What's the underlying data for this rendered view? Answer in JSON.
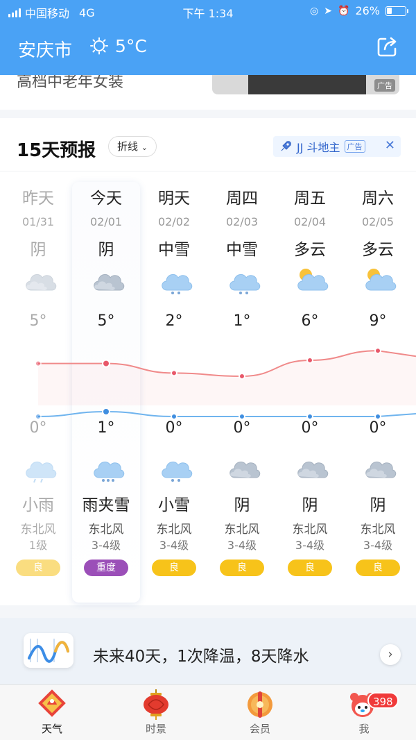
{
  "status_bar": {
    "carrier": "中国移动",
    "network": "4G",
    "time": "下午 1:34",
    "battery": "26%",
    "battery_level": 0.26
  },
  "header": {
    "city": "安庆市",
    "temp": "5°C",
    "weather_icon": "cloudy-sun-icon",
    "share_icon": "share-icon"
  },
  "ad_strip": {
    "text": "高档中老年女装",
    "tag": "广告"
  },
  "forecast": {
    "title": "15天预报",
    "mode_button": "折线",
    "ad": {
      "text": "JJ 斗地主",
      "tag": "广告",
      "close": "✕"
    },
    "days": [
      {
        "name": "昨天",
        "date": "01/31",
        "day_cond": "阴",
        "day_icon": "overcast",
        "high": "5°",
        "low": "0°",
        "night_icon": "rain",
        "night_cond": "小雨",
        "wind": "东北风",
        "level": "1级",
        "aqi": "良",
        "aqi_color": "#f7c31a"
      },
      {
        "name": "今天",
        "date": "02/01",
        "day_cond": "阴",
        "day_icon": "overcast",
        "high": "5°",
        "low": "1°",
        "night_icon": "sleet",
        "night_cond": "雨夹雪",
        "wind": "东北风",
        "level": "3-4级",
        "aqi": "重度",
        "aqi_color": "#9b4fb8"
      },
      {
        "name": "明天",
        "date": "02/02",
        "day_cond": "中雪",
        "day_icon": "snow",
        "high": "2°",
        "low": "0°",
        "night_icon": "light-snow",
        "night_cond": "小雪",
        "wind": "东北风",
        "level": "3-4级",
        "aqi": "良",
        "aqi_color": "#f7c31a"
      },
      {
        "name": "周四",
        "date": "02/03",
        "day_cond": "中雪",
        "day_icon": "snow",
        "high": "1°",
        "low": "0°",
        "night_icon": "overcast",
        "night_cond": "阴",
        "wind": "东北风",
        "level": "3-4级",
        "aqi": "良",
        "aqi_color": "#f7c31a"
      },
      {
        "name": "周五",
        "date": "02/04",
        "day_cond": "多云",
        "day_icon": "partly-cloudy",
        "high": "6°",
        "low": "0°",
        "night_icon": "overcast",
        "night_cond": "阴",
        "wind": "东北风",
        "level": "3-4级",
        "aqi": "良",
        "aqi_color": "#f7c31a"
      },
      {
        "name": "周六",
        "date": "02/05",
        "day_cond": "多云",
        "day_icon": "partly-cloudy",
        "high": "9°",
        "low": "0°",
        "night_icon": "overcast",
        "night_cond": "阴",
        "wind": "东北风",
        "level": "3-4级",
        "aqi": "良",
        "aqi_color": "#f7c31a"
      }
    ],
    "high_values": [
      5,
      5,
      2,
      1,
      6,
      9
    ],
    "low_values": [
      0,
      1,
      0,
      0,
      0,
      0
    ],
    "colors": {
      "high_line": "#f08a8a",
      "low_line": "#6fb4ee",
      "accent": "#4aa2f5"
    }
  },
  "banner": {
    "text": "未来40天，1次降温，8天降水",
    "arrow": "›"
  },
  "tabs": [
    {
      "label": "天气",
      "icon": "weather-badge-icon",
      "active": true
    },
    {
      "label": "时景",
      "icon": "lantern-icon",
      "active": false
    },
    {
      "label": "会员",
      "icon": "member-coin-icon",
      "active": false
    },
    {
      "label": "我",
      "icon": "avatar-icon",
      "active": false,
      "badge": "398"
    }
  ]
}
